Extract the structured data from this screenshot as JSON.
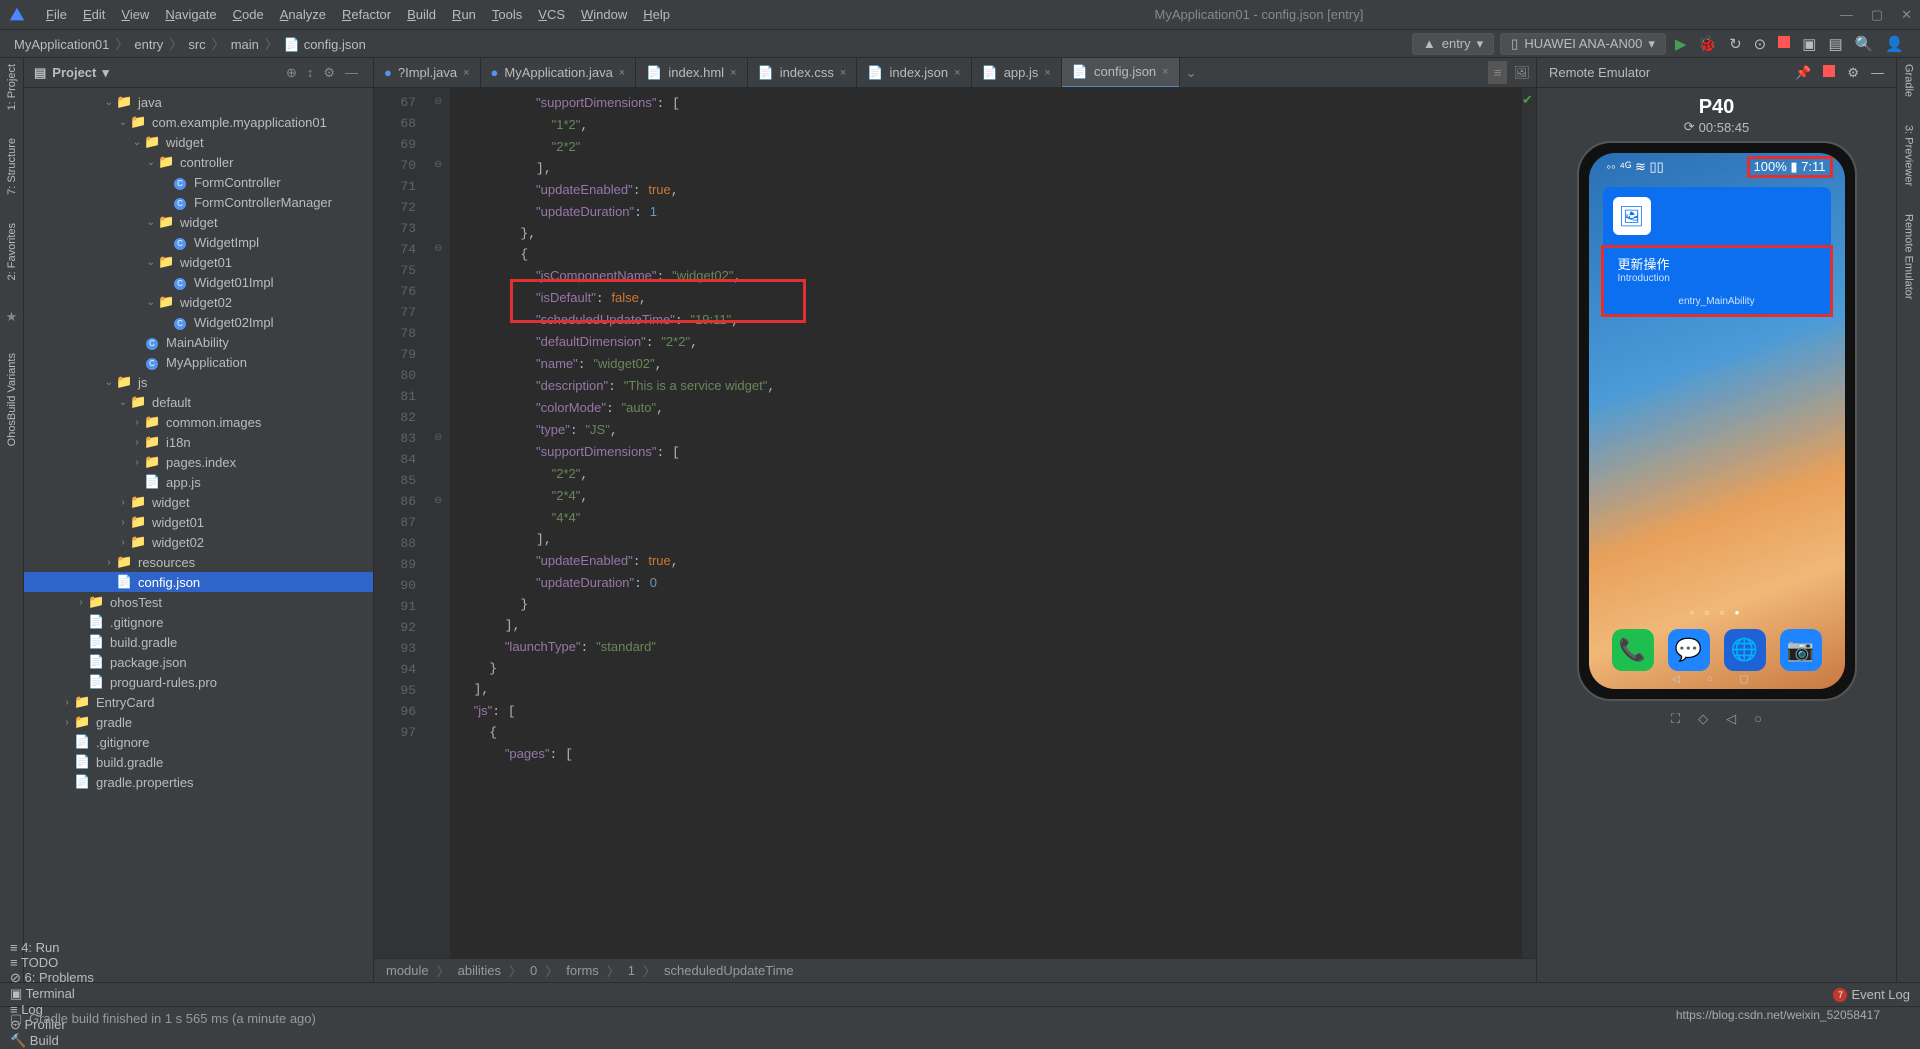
{
  "menu": {
    "items": [
      "File",
      "Edit",
      "View",
      "Navigate",
      "Code",
      "Analyze",
      "Refactor",
      "Build",
      "Run",
      "Tools",
      "VCS",
      "Window",
      "Help"
    ],
    "title": "MyApplication01 - config.json [entry]"
  },
  "nav": {
    "crumbs": [
      "MyApplication01",
      "entry",
      "src",
      "main",
      "config.json"
    ],
    "module": "entry",
    "device": "HUAWEI ANA-AN00"
  },
  "leftTabs": [
    "1: Project",
    "7: Structure",
    "2: Favorites",
    "OhosBuild Variants"
  ],
  "rightTabs": [
    "Gradle",
    "3: Previewer",
    "Remote Emulator"
  ],
  "project": {
    "title": "Project"
  },
  "tree": [
    {
      "d": 5,
      "c": "v",
      "i": "📁",
      "t": "java"
    },
    {
      "d": 6,
      "c": "v",
      "i": "📁",
      "t": "com.example.myapplication01"
    },
    {
      "d": 7,
      "c": "v",
      "i": "📁",
      "t": "widget"
    },
    {
      "d": 8,
      "c": "v",
      "i": "📁",
      "t": "controller"
    },
    {
      "d": 9,
      "c": "",
      "i": "●",
      "t": "FormController"
    },
    {
      "d": 9,
      "c": "",
      "i": "●",
      "t": "FormControllerManager"
    },
    {
      "d": 8,
      "c": "v",
      "i": "📁",
      "t": "widget"
    },
    {
      "d": 9,
      "c": "",
      "i": "●",
      "t": "WidgetImpl"
    },
    {
      "d": 8,
      "c": "v",
      "i": "📁",
      "t": "widget01"
    },
    {
      "d": 9,
      "c": "",
      "i": "●",
      "t": "Widget01Impl"
    },
    {
      "d": 8,
      "c": "v",
      "i": "📁",
      "t": "widget02"
    },
    {
      "d": 9,
      "c": "",
      "i": "●",
      "t": "Widget02Impl"
    },
    {
      "d": 7,
      "c": "",
      "i": "●",
      "t": "MainAbility"
    },
    {
      "d": 7,
      "c": "",
      "i": "●",
      "t": "MyApplication"
    },
    {
      "d": 5,
      "c": "v",
      "i": "📁",
      "t": "js"
    },
    {
      "d": 6,
      "c": "v",
      "i": "📁",
      "t": "default"
    },
    {
      "d": 7,
      "c": ">",
      "i": "📁",
      "t": "common.images"
    },
    {
      "d": 7,
      "c": ">",
      "i": "📁",
      "t": "i18n"
    },
    {
      "d": 7,
      "c": ">",
      "i": "📁",
      "t": "pages.index"
    },
    {
      "d": 7,
      "c": "",
      "i": "📄",
      "t": "app.js"
    },
    {
      "d": 6,
      "c": ">",
      "i": "📁",
      "t": "widget"
    },
    {
      "d": 6,
      "c": ">",
      "i": "📁",
      "t": "widget01"
    },
    {
      "d": 6,
      "c": ">",
      "i": "📁",
      "t": "widget02"
    },
    {
      "d": 5,
      "c": ">",
      "i": "📁",
      "t": "resources"
    },
    {
      "d": 5,
      "c": "",
      "i": "📄",
      "t": "config.json",
      "sel": true
    },
    {
      "d": 3,
      "c": ">",
      "i": "📁",
      "t": "ohosTest"
    },
    {
      "d": 3,
      "c": "",
      "i": "📄",
      "t": ".gitignore"
    },
    {
      "d": 3,
      "c": "",
      "i": "📄",
      "t": "build.gradle"
    },
    {
      "d": 3,
      "c": "",
      "i": "📄",
      "t": "package.json"
    },
    {
      "d": 3,
      "c": "",
      "i": "📄",
      "t": "proguard-rules.pro"
    },
    {
      "d": 2,
      "c": ">",
      "i": "📁",
      "t": "EntryCard"
    },
    {
      "d": 2,
      "c": ">",
      "i": "📁",
      "t": "gradle"
    },
    {
      "d": 2,
      "c": "",
      "i": "📄",
      "t": ".gitignore"
    },
    {
      "d": 2,
      "c": "",
      "i": "📄",
      "t": "build.gradle"
    },
    {
      "d": 2,
      "c": "",
      "i": "📄",
      "t": "gradle.properties"
    }
  ],
  "tabs": [
    {
      "label": "?Impl.java",
      "icon": "●"
    },
    {
      "label": "MyApplication.java",
      "icon": "●"
    },
    {
      "label": "index.hml",
      "icon": "📄"
    },
    {
      "label": "index.css",
      "icon": "📄"
    },
    {
      "label": "index.json",
      "icon": "📄"
    },
    {
      "label": "app.js",
      "icon": "📄"
    },
    {
      "label": "config.json",
      "icon": "📄",
      "active": true
    }
  ],
  "code": {
    "startLine": 67,
    "lines": [
      "          <k>\"supportDimensions\"</k>: [",
      "            <s>\"1*2\"</s>,",
      "            <s>\"2*2\"</s>",
      "          ],",
      "          <k>\"updateEnabled\"</k>: <b>true</b>,",
      "          <k>\"updateDuration\"</k>: <n>1</n>",
      "        },",
      "        {",
      "          <k>\"jsComponentName\"</k>: <s>\"widget02\"</s>,",
      "          <k>\"isDefault\"</k>: <b>false</b>,",
      "          <k>\"scheduledUpdateTime\"</k>: <s>\"19:11\"</s>,",
      "          <k>\"defaultDimension\"</k>: <s>\"2*2\"</s>,",
      "          <k>\"name\"</k>: <s>\"widget02\"</s>,",
      "          <k>\"description\"</k>: <s>\"This is a service widget\"</s>,",
      "          <k>\"colorMode\"</k>: <s>\"auto\"</s>,",
      "          <k>\"type\"</k>: <s>\"JS\"</s>,",
      "          <k>\"supportDimensions\"</k>: [",
      "            <s>\"2*2\"</s>,",
      "            <s>\"2*4\"</s>,",
      "            <s>\"4*4\"</s>",
      "          ],",
      "          <k>\"updateEnabled\"</k>: <b>true</b>,",
      "          <k>\"updateDuration\"</k>: <n>0</n>",
      "        }",
      "      ],",
      "      <k>\"launchType\"</k>: <s>\"standard\"</s>",
      "    }",
      "  ],",
      "  <k>\"js\"</k>: [",
      "    {",
      "      <k>\"pages\"</k>: ["
    ]
  },
  "breadcrumbs": [
    "module",
    "abilities",
    "0",
    "forms",
    "1",
    "scheduledUpdateTime"
  ],
  "preview": {
    "title": "Remote Emulator",
    "device": "P40",
    "timer": "00:58:45",
    "battery": "100%",
    "clock": "7:11",
    "widgetTitle": "更新操作",
    "widgetSub": "Introduction",
    "widgetFoot": "entry_MainAbility"
  },
  "bottomTools": [
    "≡ 4: Run",
    "≡ TODO",
    "⊘ 6: Problems",
    "▣ Terminal",
    "≡ Log",
    "⊙ Profiler",
    "🔨 Build"
  ],
  "eventLog": "Event Log",
  "status": "Gradle build finished in 1 s 565 ms (a minute ago)",
  "watermark": "https://blog.csdn.net/weixin_52058417"
}
